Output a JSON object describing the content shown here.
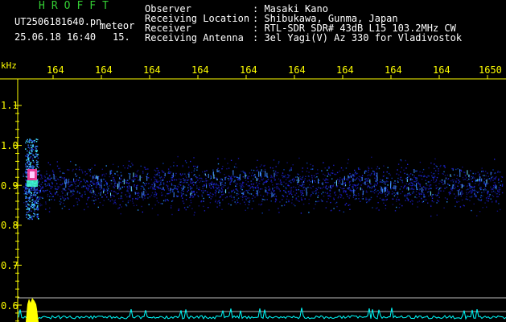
{
  "header": {
    "brand": "HROFFT",
    "filename": "UT2506181640.pn",
    "mode": "meteor",
    "datetime": "25.06.18 16:40",
    "interval": "15.",
    "info_labels": [
      "Observer",
      "Receiving Location",
      "Receiver",
      "Receiving Antenna"
    ],
    "info_values": [
      ": Masaki Kano",
      ": Shibukawa, Gunma, Japan",
      ": RTL-SDR SDR# 43dB L15 103.2MHz CW",
      ": 3el Yagi(V) Az 330 for Vladivostok"
    ]
  },
  "axis": {
    "unit": "kHz",
    "time_ticks": [
      "164",
      "164",
      "164",
      "164",
      "164",
      "164",
      "164",
      "164",
      "164",
      "1650"
    ],
    "freq_ticks": [
      "1.1",
      "1.0",
      "0.9",
      "0.8",
      "0.7",
      "0.6"
    ]
  },
  "colors": {
    "text": "#ffffff",
    "brand": "#33cc33",
    "axis": "#ffff00",
    "signal": "#00ffff",
    "background": "#000000"
  }
}
